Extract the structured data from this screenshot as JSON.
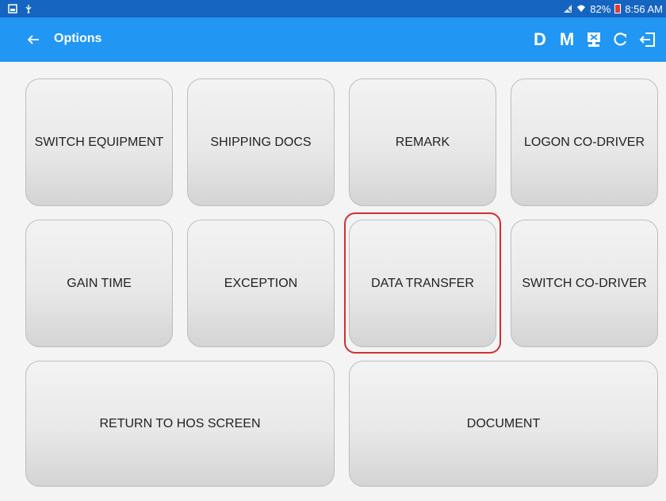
{
  "status_bar": {
    "battery": "82%",
    "time": "8:56 AM"
  },
  "app_bar": {
    "title": "Options",
    "back_icon": "arrow-left-icon",
    "actions": [
      {
        "label": "D",
        "icon": "letter-d"
      },
      {
        "label": "M",
        "icon": "letter-m"
      },
      {
        "label": "",
        "icon": "monitor-icon"
      },
      {
        "label": "",
        "icon": "refresh-icon"
      },
      {
        "label": "",
        "icon": "logout-icon"
      }
    ]
  },
  "tiles": [
    {
      "label": "SWITCH EQUIPMENT"
    },
    {
      "label": "SHIPPING DOCS"
    },
    {
      "label": "REMARK"
    },
    {
      "label": "LOGON CO-DRIVER"
    },
    {
      "label": "GAIN TIME"
    },
    {
      "label": "EXCEPTION"
    },
    {
      "label": "DATA TRANSFER"
    },
    {
      "label": "SWITCH CO-DRIVER"
    },
    {
      "label": "RETURN TO HOS SCREEN"
    },
    {
      "label": "DOCUMENT"
    }
  ],
  "colors": {
    "status_bar": "#1565c0",
    "app_bar": "#2196f3",
    "highlight": "#d32f2f",
    "background": "#f4f4f4"
  }
}
